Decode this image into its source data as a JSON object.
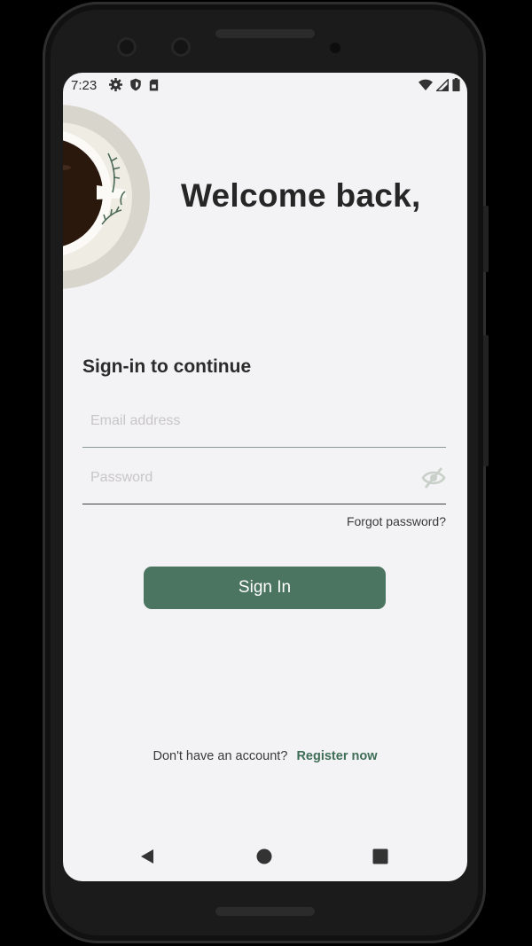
{
  "status_bar": {
    "time": "7:23",
    "left_icons": [
      "settings-icon",
      "shield-icon",
      "sim-card-icon"
    ],
    "right_icons": [
      "wifi-icon",
      "signal-icon",
      "battery-icon"
    ]
  },
  "header": {
    "title": "Welcome back,",
    "image": "coffee-cup-illustration"
  },
  "form": {
    "subtitle": "Sign-in to continue",
    "email_placeholder": "Email address",
    "email_value": "",
    "password_placeholder": "Password",
    "password_value": "",
    "visibility_icon": "eye-off-icon",
    "forgot_label": "Forgot password?",
    "submit_label": "Sign In"
  },
  "footer": {
    "prompt": "Don't have an account?",
    "register_label": "Register now"
  },
  "nav_bar": {
    "items": [
      "back-icon",
      "home-icon",
      "recents-icon"
    ]
  },
  "colors": {
    "accent": "#4b7560",
    "link": "#3f6e57",
    "background": "#f3f2f4",
    "title_text": "#262626",
    "placeholder": "#c8c6c6"
  }
}
